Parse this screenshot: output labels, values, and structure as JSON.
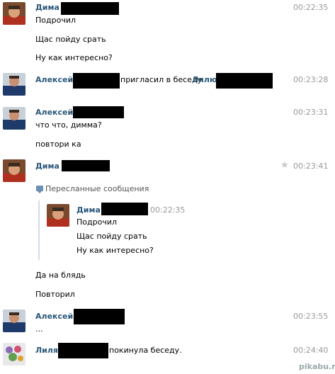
{
  "messages": {
    "m1": {
      "author": "Дима",
      "time": "00:22:35",
      "lines": [
        "Подрочил",
        "Щас пойду срать",
        "Ну как интересно?"
      ]
    },
    "m2": {
      "author": "Алексей",
      "action": "пригласил в беседу",
      "target": "Лилю",
      "time": "00:23:28"
    },
    "m3": {
      "author": "Алексей",
      "time": "00:23:31",
      "lines": [
        "что что, димма?",
        "повтори ка"
      ]
    },
    "m4": {
      "author": "Дима",
      "time": "00:23:41",
      "forwarded_label": "Пересланные сообщения",
      "forwarded": {
        "author": "Дима",
        "time": "00:22:35",
        "lines": [
          "Подрочил",
          "Щас пойду срать",
          "Ну как интересно?"
        ]
      },
      "lines": [
        "Да на блядь",
        "Повторил"
      ]
    },
    "m5": {
      "author": "Алексей",
      "time": "00:23:55",
      "lines": [
        "..."
      ]
    },
    "m6": {
      "author": "Лиля",
      "action": "покинула беседу.",
      "time": "00:24:40"
    }
  },
  "watermark": "pikabu.ru",
  "icons": {
    "star": "star-icon",
    "forward": "speech-bubble-icon"
  },
  "colors": {
    "name": "#2b587a",
    "time": "#999999",
    "redaction": "#000000"
  }
}
